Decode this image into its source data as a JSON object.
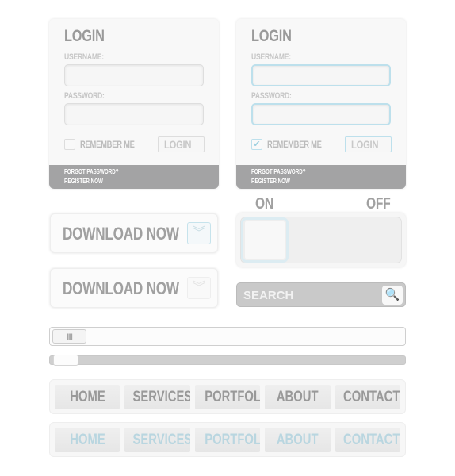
{
  "login_default": {
    "title": "LOGIN",
    "username_label": "USERNAME:",
    "username_value": "",
    "password_label": "PASSWORD:",
    "password_value": "",
    "remember_label": "REMEMBER ME",
    "remember_checked": false,
    "login_button": "LOGIN",
    "forgot_link": "FORGOT PASSWORD?",
    "register_link": "REGISTER NOW"
  },
  "login_focused": {
    "title": "LOGIN",
    "username_label": "USERNAME:",
    "username_value": "",
    "password_label": "PASSWORD:",
    "password_value": "",
    "remember_label": "REMEMBER ME",
    "remember_checked": true,
    "check_glyph": "✔",
    "login_button": "LOGIN",
    "forgot_link": "FORGOT PASSWORD?",
    "register_link": "REGISTER NOW"
  },
  "download_buttons": [
    {
      "label": "DOWNLOAD NOW",
      "icon": "double-chevron-down-icon",
      "glyph": "︾"
    },
    {
      "label": "DOWNLOAD NOW",
      "icon": "double-chevron-down-icon",
      "glyph": "︾"
    }
  ],
  "toggle": {
    "on_label": "ON",
    "off_label": "OFF",
    "state": "on"
  },
  "search": {
    "placeholder": "SEARCH",
    "value": "",
    "icon_glyph": "🔍"
  },
  "scrollbars": [
    {
      "grip_glyph": "III",
      "position": 0.0
    },
    {
      "position": 0.0
    }
  ],
  "nav_default": [
    "HOME",
    "SERVICES",
    "PORTFOLIO",
    "ABOUT US",
    "CONTACT"
  ],
  "nav_hover": [
    "HOME",
    "SERVICES",
    "PORTFOLIO",
    "ABOUT US",
    "CONTACT"
  ],
  "colors": {
    "accent": "#bde0ec",
    "footer": "#a3a3a4",
    "text": "#a0a0a0"
  }
}
